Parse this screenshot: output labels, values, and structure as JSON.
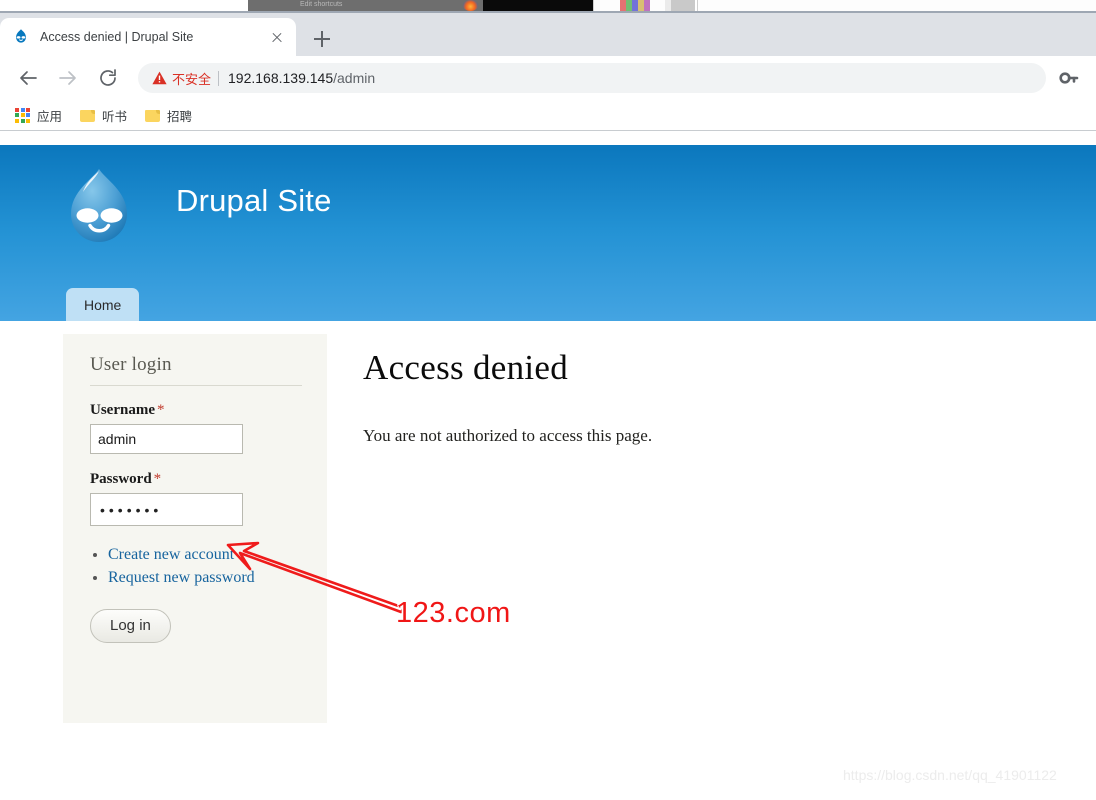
{
  "background_window": {
    "partial_label": "Edit shortcuts"
  },
  "browser": {
    "tab": {
      "title": "Access denied | Drupal Site",
      "favicon_name": "drupal-favicon",
      "close_label": "×"
    },
    "new_tab_label": "+",
    "nav": {
      "back_label": "Back",
      "forward_label": "Forward",
      "reload_label": "Reload"
    },
    "omnibox": {
      "security_text": "不安全",
      "url_host": "192.168.139.145",
      "url_path": "/admin",
      "key_icon_label": "Saved password"
    },
    "bookmarks": [
      {
        "label": "应用",
        "icon": "apps-grid-icon"
      },
      {
        "label": "听书",
        "icon": "folder-icon"
      },
      {
        "label": "招聘",
        "icon": "folder-icon"
      }
    ]
  },
  "site": {
    "name": "Drupal Site",
    "logo_name": "drupal-droplet-logo",
    "nav_tabs": [
      {
        "label": "Home"
      }
    ]
  },
  "sidebar": {
    "block_title": "User login",
    "username": {
      "label": "Username",
      "required_mark": "*",
      "value": "admin",
      "placeholder": ""
    },
    "password": {
      "label": "Password",
      "required_mark": "*",
      "masked_value": "•••••••",
      "placeholder": ""
    },
    "links": [
      {
        "label": "Create new account"
      },
      {
        "label": "Request new password"
      }
    ],
    "submit_label": "Log in"
  },
  "main": {
    "title": "Access denied",
    "body_text": "You are not authorized to access this page."
  },
  "annotation": {
    "text": "123.com",
    "color": "#f01616",
    "arrow_name": "red-annotation-arrow"
  },
  "watermark": {
    "text": "https://blog.csdn.net/qq_41901122"
  },
  "colors": {
    "header_gradient_top": "#0b77bd",
    "header_gradient_bottom": "#44a4e2",
    "nav_tab_bg": "#bfe0f5",
    "sidebar_bg": "#f6f6f1",
    "link_blue": "#17649e",
    "required_red": "#c0392b",
    "not_secure_red": "#d93025"
  }
}
